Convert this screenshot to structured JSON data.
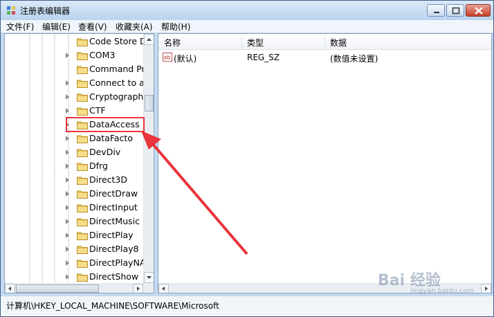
{
  "window": {
    "title": "注册表编辑器"
  },
  "menu": [
    "文件(F)",
    "编辑(E)",
    "查看(V)",
    "收藏夹(A)",
    "帮助(H)"
  ],
  "tree": {
    "items": [
      {
        "label": "Code Store D",
        "has_expander": false
      },
      {
        "label": "COM3",
        "has_expander": true
      },
      {
        "label": "Command Pr",
        "has_expander": false
      },
      {
        "label": "Connect to a",
        "has_expander": true
      },
      {
        "label": "Cryptography",
        "has_expander": true
      },
      {
        "label": "CTF",
        "has_expander": true
      },
      {
        "label": "DataAccess",
        "has_expander": true,
        "highlighted": true
      },
      {
        "label": "DataFacto",
        "has_expander": true
      },
      {
        "label": "DevDiv",
        "has_expander": true
      },
      {
        "label": "Dfrg",
        "has_expander": true
      },
      {
        "label": "Direct3D",
        "has_expander": true
      },
      {
        "label": "DirectDraw",
        "has_expander": true
      },
      {
        "label": "DirectInput",
        "has_expander": true
      },
      {
        "label": "DirectMusic",
        "has_expander": true
      },
      {
        "label": "DirectPlay",
        "has_expander": true
      },
      {
        "label": "DirectPlay8",
        "has_expander": true
      },
      {
        "label": "DirectPlayNAT",
        "has_expander": true
      },
      {
        "label": "DirectShow",
        "has_expander": true
      }
    ]
  },
  "list": {
    "columns": [
      "名称",
      "类型",
      "数据"
    ],
    "rows": [
      {
        "name": "(默认)",
        "type": "REG_SZ",
        "data": "(数值未设置)",
        "icon": "ab-string-icon"
      }
    ]
  },
  "statusbar": {
    "path": "计算机\\HKEY_LOCAL_MACHINE\\SOFTWARE\\Microsoft"
  },
  "watermark": {
    "text": "Bai 经验",
    "url": "jingyan.baidu.com"
  },
  "colors": {
    "highlight": "#e8343a",
    "folder": "#e8c35a"
  }
}
